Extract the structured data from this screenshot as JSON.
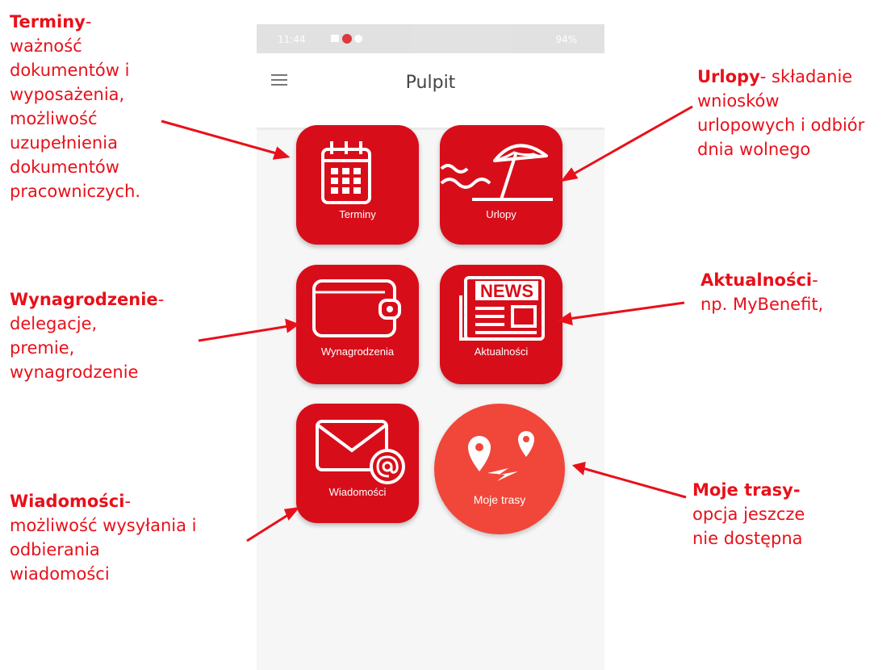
{
  "status_bar": {
    "time": "11:44",
    "battery": "94%"
  },
  "header": {
    "title": "Pulpit"
  },
  "tiles": {
    "terminy": "Terminy",
    "urlopy": "Urlopy",
    "wynagrodzenia": "Wynagrodzenia",
    "aktualnosci": "Aktualności",
    "wiadomosci": "Wiadomości",
    "moje_trasy": "Moje trasy"
  },
  "icons": {
    "terminy": "calendar-icon",
    "urlopy": "beach-umbrella-icon",
    "wynagrodzenia": "wallet-icon",
    "aktualnosci": "newspaper-icon",
    "wiadomosci": "envelope-at-icon",
    "moje_trasy": "route-pins-icon"
  },
  "annotations": {
    "terminy": {
      "title": "Terminy",
      "lines": [
        "ważność",
        "dokumentów i",
        "wyposażenia,",
        "możliwość",
        "uzupełnienia",
        "dokumentów",
        "pracowniczych."
      ]
    },
    "urlopy": {
      "title": "Urlopy",
      "rest": "- składanie",
      "lines": [
        "wniosków",
        "urlopowych i odbiór",
        "dnia wolnego"
      ]
    },
    "wynagrodzenie": {
      "title": "Wynagrodzenie",
      "lines": [
        "delegacje,",
        "premie,",
        "wynagrodzenie"
      ]
    },
    "aktualnosci": {
      "title": "Aktualności",
      "lines": [
        "np. MyBenefit,"
      ]
    },
    "wiadomosci": {
      "title": "Wiadomości",
      "lines": [
        "możliwość wysyłania i",
        "odbierania",
        "wiadomości"
      ]
    },
    "moje_trasy": {
      "title": "Moje trasy-",
      "lines": [
        "opcja jeszcze",
        "nie dostępna"
      ]
    }
  },
  "colors": {
    "annotation": "#e8101a",
    "tile": "#d70e1a",
    "round_tile": "#f0473a"
  }
}
